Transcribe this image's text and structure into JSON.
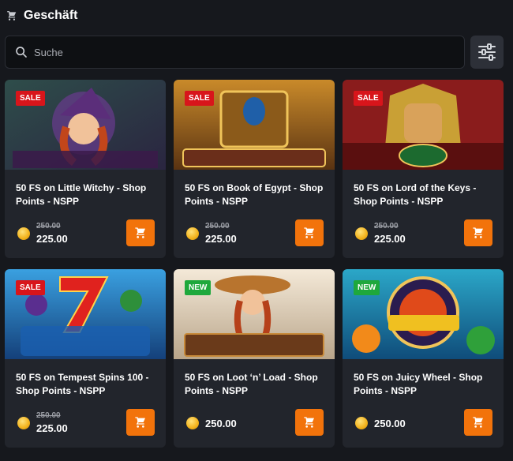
{
  "header": {
    "title": "Geschäft",
    "icon": "shopping-cart-icon"
  },
  "search": {
    "placeholder": "Suche",
    "value": ""
  },
  "filter": {
    "icon": "sliders-icon"
  },
  "accent": "#f2730b",
  "products": [
    {
      "name": "50 FS on Little Witchy - Shop Points - NSPP",
      "game": "LITTLE WITCHY",
      "badge": "SALE",
      "old_price": "250.00",
      "price": "225.00"
    },
    {
      "name": "50 FS on Book of Egypt - Shop Points - NSPP",
      "game": "BOOK OF EGYPT",
      "badge": "SALE",
      "old_price": "250.00",
      "price": "225.00"
    },
    {
      "name": "50 FS on Lord of the Keys - Shop Points - NSPP",
      "game": "LORD OF THE KEYS",
      "badge": "SALE",
      "old_price": "250.00",
      "price": "225.00"
    },
    {
      "name": "50 FS on Tempest Spins 100 - Shop Points - NSPP",
      "game": "TEMPEST Spins 100",
      "badge": "SALE",
      "old_price": "250.00",
      "price": "225.00"
    },
    {
      "name": "50 FS on Loot ‘n’ Load - Shop Points - NSPP",
      "game": "LOOT 'N' LOAD",
      "badge": "NEW",
      "old_price": "",
      "price": "250.00"
    },
    {
      "name": "50 FS on Juicy Wheel - Shop Points - NSPP",
      "game": "JUICY WHEEL",
      "badge": "NEW",
      "old_price": "",
      "price": "250.00"
    }
  ]
}
